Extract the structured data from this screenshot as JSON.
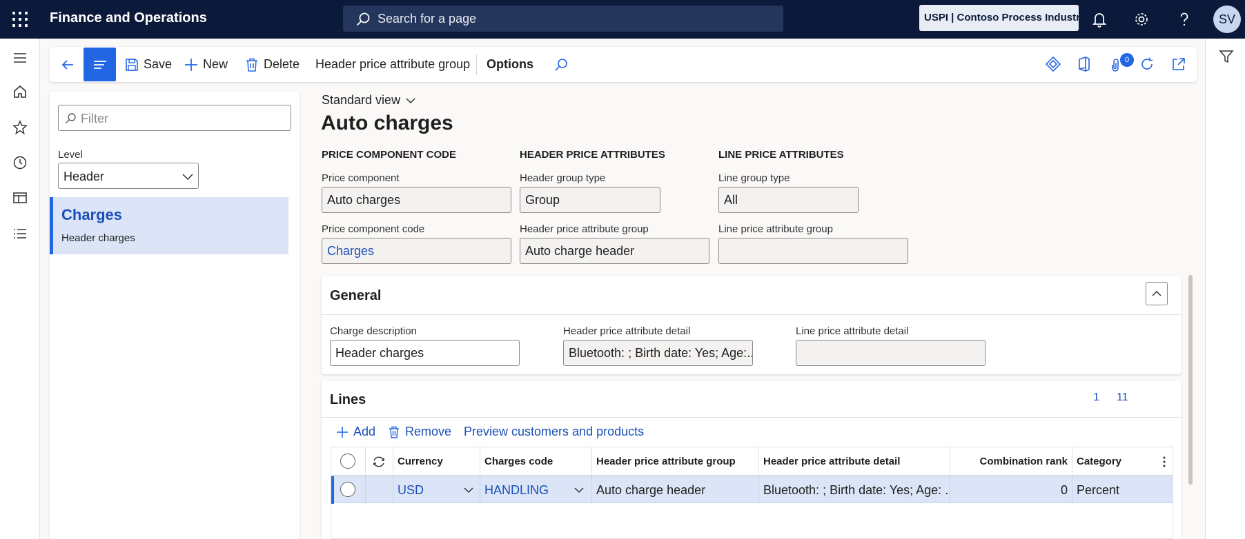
{
  "app": {
    "title": "Finance and Operations",
    "search_placeholder": "Search for a page",
    "company": "USPI | Contoso Process Industry",
    "user_initials": "SV"
  },
  "action_pane": {
    "save": "Save",
    "new": "New",
    "delete": "Delete",
    "header_group": "Header price attribute group",
    "options": "Options",
    "attachments_count": "0"
  },
  "list_pane": {
    "filter_placeholder": "Filter",
    "level_label": "Level",
    "level_value": "Header",
    "items": [
      {
        "title": "Charges",
        "subtitle": "Header charges"
      }
    ]
  },
  "details": {
    "view": "Standard view",
    "title": "Auto charges",
    "sections": {
      "price_component_code": "PRICE COMPONENT CODE",
      "header_price_attributes": "HEADER PRICE ATTRIBUTES",
      "line_price_attributes": "LINE PRICE ATTRIBUTES"
    },
    "fields": {
      "price_component_label": "Price component",
      "price_component_value": "Auto charges",
      "price_component_code_label": "Price component code",
      "price_component_code_value": "Charges",
      "header_group_type_label": "Header group type",
      "header_group_type_value": "Group",
      "header_price_attribute_group_label": "Header price attribute group",
      "header_price_attribute_group_value": "Auto charge header",
      "line_group_type_label": "Line group type",
      "line_group_type_value": "All",
      "line_price_attribute_group_label": "Line price attribute group",
      "line_price_attribute_group_value": ""
    }
  },
  "general": {
    "title": "General",
    "charge_description_label": "Charge description",
    "charge_description_value": "Header charges",
    "header_detail_label": "Header price attribute detail",
    "header_detail_value": "Bluetooth: ; Birth date: Yes; Age:...",
    "line_detail_label": "Line price attribute detail",
    "line_detail_value": ""
  },
  "lines": {
    "title": "Lines",
    "pager_current": "1",
    "pager_total": "11",
    "add": "Add",
    "remove": "Remove",
    "preview": "Preview customers and products",
    "columns": {
      "currency": "Currency",
      "charges_code": "Charges code",
      "header_group": "Header price attribute group",
      "header_detail": "Header price attribute detail",
      "combination_rank": "Combination rank",
      "category": "Category"
    },
    "rows": [
      {
        "currency": "USD",
        "charges_code": "HANDLING",
        "header_group": "Auto charge header",
        "header_detail": "Bluetooth: ; Birth date: Yes; Age: ...",
        "combination_rank": "0",
        "category": "Percent"
      }
    ]
  },
  "colors": {
    "navy": "#0b1a3a",
    "accent": "#2266e3",
    "link": "#1b4fb8",
    "selected_row": "#dbe5f7"
  }
}
